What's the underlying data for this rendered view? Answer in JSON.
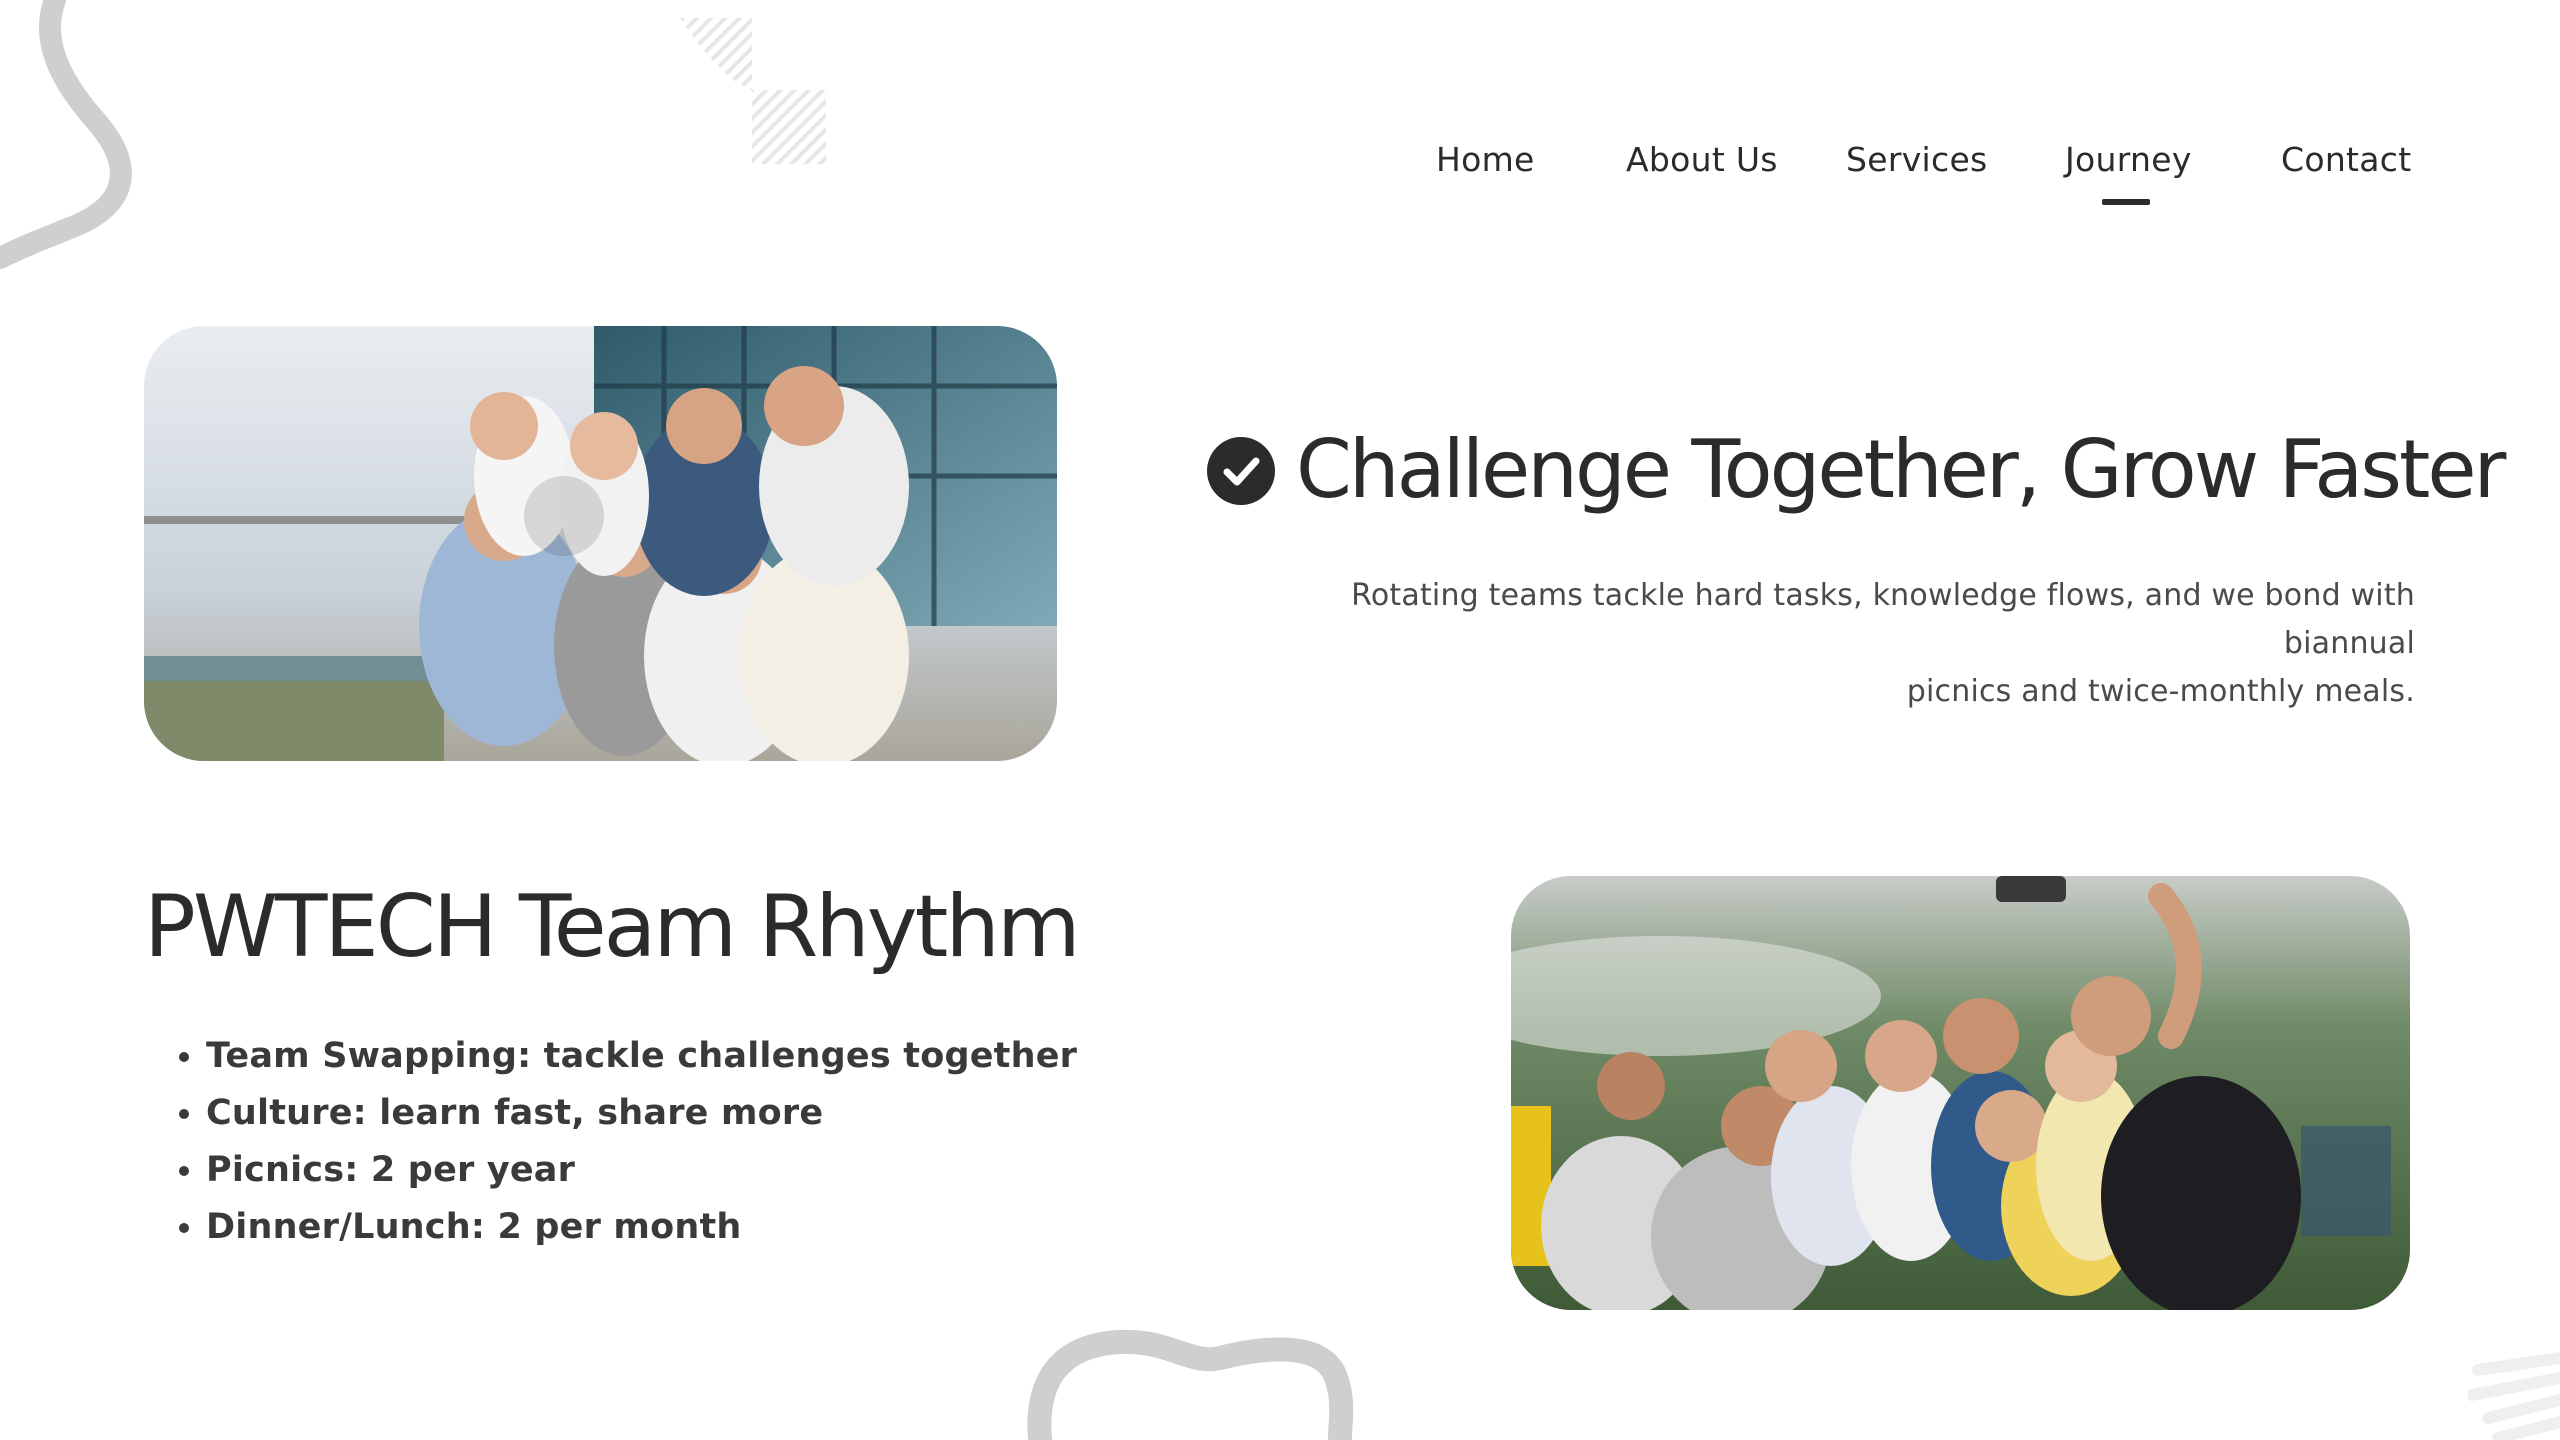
{
  "nav": {
    "items": [
      {
        "label": "Home"
      },
      {
        "label": "About Us"
      },
      {
        "label": "Services"
      },
      {
        "label": "Journey",
        "active": true
      },
      {
        "label": "Contact"
      }
    ]
  },
  "section1": {
    "icon": "check-circle-icon",
    "heading": "Challenge Together, Grow Faster",
    "subtext_line1": "Rotating teams tackle hard tasks, knowledge flows, and we bond with biannual",
    "subtext_line2": "picnics and twice-monthly meals."
  },
  "section2": {
    "heading": "PWTECH Team Rhythm",
    "bullets": [
      "Team Swapping: tackle challenges together",
      "Culture: learn fast, share more",
      "Picnics: 2 per year",
      "Dinner/Lunch: 2 per month"
    ]
  },
  "colors": {
    "text": "#2b2b2b",
    "decoration": "#cfcfcf",
    "background": "#ffffff"
  }
}
